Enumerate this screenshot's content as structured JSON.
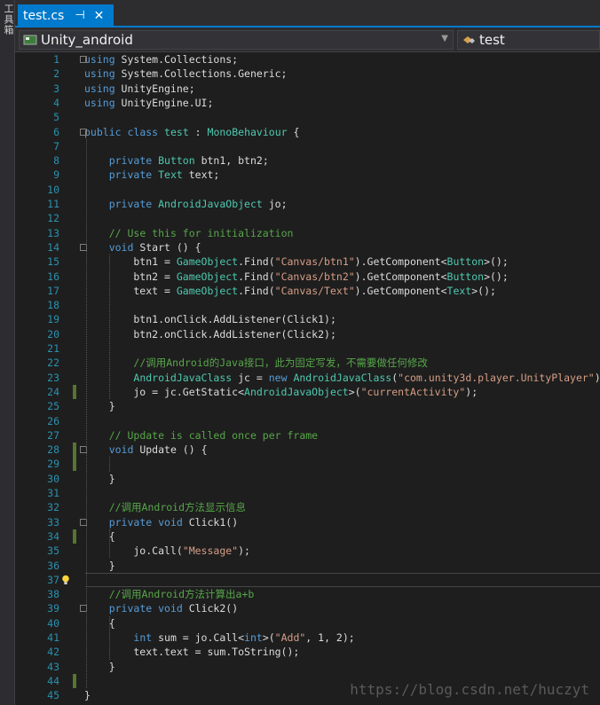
{
  "side_toolbar": {
    "label": "工具箱"
  },
  "tab": {
    "title": "test.cs",
    "pin_icon": "pin-icon",
    "close_icon": "close-icon"
  },
  "navbar": {
    "project": "Unity_android",
    "member": "test"
  },
  "editor": {
    "lines": [
      {
        "n": "1",
        "html": "<span class=\"kw\">using</span> System.Collections;"
      },
      {
        "n": "2",
        "html": "<span class=\"kw\">using</span> System.Collections.Generic;"
      },
      {
        "n": "3",
        "html": "<span class=\"kw\">using</span> UnityEngine;"
      },
      {
        "n": "4",
        "html": "<span class=\"kw\">using</span> UnityEngine.UI;"
      },
      {
        "n": "5",
        "html": ""
      },
      {
        "n": "6",
        "html": "<span class=\"kw\">public</span> <span class=\"kw\">class</span> <span class=\"ty\">test</span> : <span class=\"ty\">MonoBehaviour</span> {"
      },
      {
        "n": "7",
        "html": ""
      },
      {
        "n": "8",
        "html": "    <span class=\"kw\">private</span> <span class=\"ty\">Button</span> btn1, btn2;"
      },
      {
        "n": "9",
        "html": "    <span class=\"kw\">private</span> <span class=\"ty\">Text</span> text;"
      },
      {
        "n": "10",
        "html": ""
      },
      {
        "n": "11",
        "html": "    <span class=\"kw\">private</span> <span class=\"ty\">AndroidJavaObject</span> jo;"
      },
      {
        "n": "12",
        "html": ""
      },
      {
        "n": "13",
        "html": "    <span class=\"cm\">// Use this for initialization</span>"
      },
      {
        "n": "14",
        "html": "    <span class=\"kw\">void</span> Start () {"
      },
      {
        "n": "15",
        "html": "        btn1 = <span class=\"ty\">GameObject</span>.Find(<span class=\"st\">\"Canvas/btn1\"</span>).GetComponent&lt;<span class=\"ty\">Button</span>&gt;();"
      },
      {
        "n": "16",
        "html": "        btn2 = <span class=\"ty\">GameObject</span>.Find(<span class=\"st\">\"Canvas/btn2\"</span>).GetComponent&lt;<span class=\"ty\">Button</span>&gt;();"
      },
      {
        "n": "17",
        "html": "        text = <span class=\"ty\">GameObject</span>.Find(<span class=\"st\">\"Canvas/Text\"</span>).GetComponent&lt;<span class=\"ty\">Text</span>&gt;();"
      },
      {
        "n": "18",
        "html": ""
      },
      {
        "n": "19",
        "html": "        btn1.onClick.AddListener(Click1);"
      },
      {
        "n": "20",
        "html": "        btn2.onClick.AddListener(Click2);"
      },
      {
        "n": "21",
        "html": ""
      },
      {
        "n": "22",
        "html": "        <span class=\"cm\">//调用Android的Java接口，此为固定写发，不需要做任何修改</span>"
      },
      {
        "n": "23",
        "html": "        <span class=\"ty\">AndroidJavaClass</span> jc = <span class=\"kw\">new</span> <span class=\"ty\">AndroidJavaClass</span>(<span class=\"st\">\"com.unity3d.player.UnityPlayer\"</span>);"
      },
      {
        "n": "24",
        "html": "        jo = jc.GetStatic&lt;<span class=\"ty\">AndroidJavaObject</span>&gt;(<span class=\"st\">\"currentActivity\"</span>);"
      },
      {
        "n": "25",
        "html": "    }"
      },
      {
        "n": "26",
        "html": ""
      },
      {
        "n": "27",
        "html": "    <span class=\"cm\">// Update is called once per frame</span>"
      },
      {
        "n": "28",
        "html": "    <span class=\"kw\">void</span> Update () {"
      },
      {
        "n": "29",
        "html": ""
      },
      {
        "n": "30",
        "html": "    }"
      },
      {
        "n": "31",
        "html": ""
      },
      {
        "n": "32",
        "html": "    <span class=\"cm\">//调用Android方法显示信息</span>"
      },
      {
        "n": "33",
        "html": "    <span class=\"kw\">private</span> <span class=\"kw\">void</span> Click1()"
      },
      {
        "n": "34",
        "html": "    {"
      },
      {
        "n": "35",
        "html": "        jo.Call(<span class=\"st\">\"Message\"</span>);"
      },
      {
        "n": "36",
        "html": "    }"
      },
      {
        "n": "37",
        "html": ""
      },
      {
        "n": "38",
        "html": "    <span class=\"cm\">//调用Android方法计算出a+b</span>"
      },
      {
        "n": "39",
        "html": "    <span class=\"kw\">private</span> <span class=\"kw\">void</span> Click2()"
      },
      {
        "n": "40",
        "html": "    {"
      },
      {
        "n": "41",
        "html": "        <span class=\"kw\">int</span> sum = jo.Call&lt;<span class=\"kw\">int</span>&gt;(<span class=\"st\">\"Add\"</span>, 1, 2);"
      },
      {
        "n": "42",
        "html": "        text.text = sum.ToString();"
      },
      {
        "n": "43",
        "html": "    }"
      },
      {
        "n": "44",
        "html": ""
      },
      {
        "n": "45",
        "html": "}"
      }
    ],
    "changed_lines": [
      24,
      28,
      29,
      34,
      44
    ],
    "fold_lines": [
      1,
      6,
      14,
      28,
      33,
      39
    ],
    "lightbulb_line": 37
  },
  "watermark": "https://blog.csdn.net/huczyt",
  "colors": {
    "keyword": "#569cd6",
    "type": "#4ec9b0",
    "comment": "#57a64a",
    "string": "#d69d85",
    "line_number": "#2b91af",
    "accent": "#007acc"
  }
}
